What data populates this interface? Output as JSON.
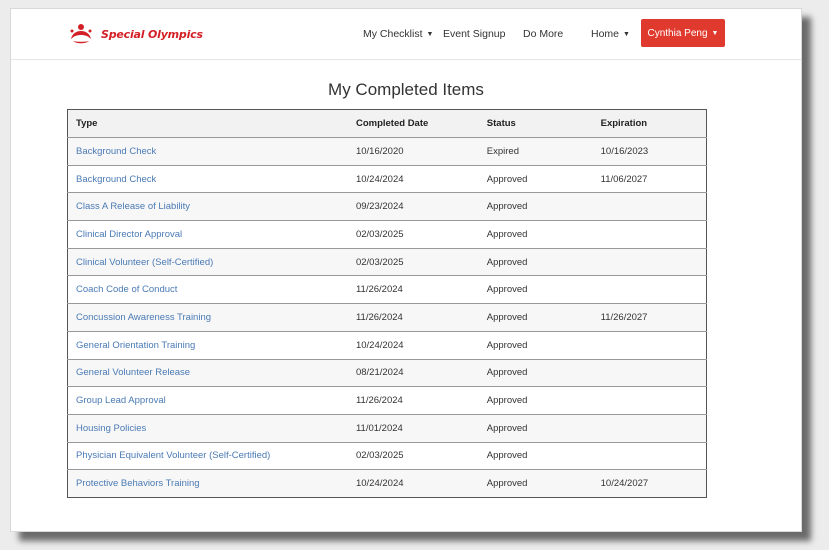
{
  "brand": {
    "name": "Special Olympics",
    "color": "#d32027"
  },
  "nav": {
    "items": [
      {
        "label": "My Checklist",
        "dropdown": true
      },
      {
        "label": "Event Signup",
        "dropdown": false
      },
      {
        "label": "Do More",
        "dropdown": false
      },
      {
        "label": "Home",
        "dropdown": true
      }
    ],
    "user": {
      "label": "Cynthia Peng",
      "color": "#e03a2f"
    }
  },
  "page": {
    "title": "My Completed Items"
  },
  "table": {
    "headers": [
      "Type",
      "Completed Date",
      "Status",
      "Expiration"
    ],
    "rows": [
      {
        "type": "Background Check",
        "completed": "10/16/2020",
        "status": "Expired",
        "expiration": "10/16/2023"
      },
      {
        "type": "Background Check",
        "completed": "10/24/2024",
        "status": "Approved",
        "expiration": "11/06/2027"
      },
      {
        "type": "Class A Release of Liability",
        "completed": "09/23/2024",
        "status": "Approved",
        "expiration": ""
      },
      {
        "type": "Clinical Director Approval",
        "completed": "02/03/2025",
        "status": "Approved",
        "expiration": ""
      },
      {
        "type": "Clinical Volunteer (Self-Certified)",
        "completed": "02/03/2025",
        "status": "Approved",
        "expiration": ""
      },
      {
        "type": "Coach Code of Conduct",
        "completed": "11/26/2024",
        "status": "Approved",
        "expiration": ""
      },
      {
        "type": "Concussion Awareness Training",
        "completed": "11/26/2024",
        "status": "Approved",
        "expiration": "11/26/2027"
      },
      {
        "type": "General Orientation Training",
        "completed": "10/24/2024",
        "status": "Approved",
        "expiration": ""
      },
      {
        "type": "General Volunteer Release",
        "completed": "08/21/2024",
        "status": "Approved",
        "expiration": ""
      },
      {
        "type": "Group Lead Approval",
        "completed": "11/26/2024",
        "status": "Approved",
        "expiration": ""
      },
      {
        "type": "Housing Policies",
        "completed": "11/01/2024",
        "status": "Approved",
        "expiration": ""
      },
      {
        "type": "Physician Equivalent Volunteer (Self-Certified)",
        "completed": "02/03/2025",
        "status": "Approved",
        "expiration": ""
      },
      {
        "type": "Protective Behaviors Training",
        "completed": "10/24/2024",
        "status": "Approved",
        "expiration": "10/24/2027"
      }
    ]
  }
}
